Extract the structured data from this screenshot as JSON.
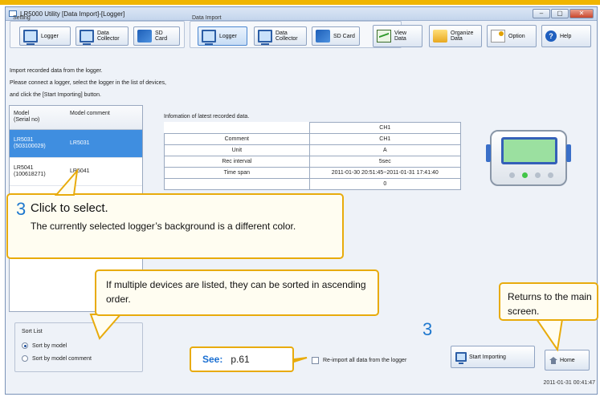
{
  "window": {
    "title": "LR5000 Utility [Data Import]-[Logger]",
    "controls": [
      "–",
      "▢",
      "✕"
    ]
  },
  "toolbar": {
    "setting_label": "Setting",
    "data_import_label": "Data Import",
    "setting_buttons": [
      {
        "label": "Logger",
        "icon": "logger-icon"
      },
      {
        "label": "Data\nCollector",
        "icon": "data-collector-icon"
      },
      {
        "label": "SD Card",
        "icon": "sd-card-icon"
      }
    ],
    "import_buttons": [
      {
        "label": "Logger",
        "icon": "logger-icon",
        "active": true
      },
      {
        "label": "Data\nCollector",
        "icon": "data-collector-icon"
      },
      {
        "label": "SD Card",
        "icon": "sd-card-icon"
      }
    ],
    "right_buttons": [
      {
        "label": "View\nData",
        "icon": "chart-icon"
      },
      {
        "label": "Organize\nData",
        "icon": "folder-icon"
      },
      {
        "label": "Option",
        "icon": "option-icon"
      },
      {
        "label": "Help",
        "icon": "help-icon"
      }
    ]
  },
  "instructions": [
    "Import recorded data from the logger.",
    "Please connect a logger, select the logger in the list of devices,",
    "and click the [Start Importing] button."
  ],
  "device_list": {
    "columns": [
      "Model\n(Serial no)",
      "Model comment"
    ],
    "rows": [
      {
        "model": "LR5031\n(503100029)",
        "comment": "LR5031",
        "selected": true
      },
      {
        "model": "LR5041\n(100618271)",
        "comment": "LR5041",
        "selected": false
      }
    ]
  },
  "info": {
    "caption": "Infomation of latest recorded data.",
    "header": "CH1",
    "rows": [
      {
        "label": "Comment",
        "value": "CH1"
      },
      {
        "label": "Unit",
        "value": "A"
      },
      {
        "label": "Rec interval",
        "value": "5sec"
      },
      {
        "label": "Time span",
        "value": "2011-01-30 20:51:45~2011-01-31 17:41:40"
      },
      {
        "label": "",
        "value": "0"
      }
    ]
  },
  "sort": {
    "title": "Sort List",
    "options": [
      {
        "label": "Sort by model",
        "selected": true
      },
      {
        "label": "Sort by model comment",
        "selected": false
      }
    ]
  },
  "reimport_label": "Re-import all data from the logger",
  "start_button": "Start Importing",
  "home_button": "Home",
  "status_time": "2011-01-31 00:41:47",
  "annotations": {
    "step_number": "3",
    "select_title": "Click to select.",
    "select_body": "The currently selected logger’s background is a different color.",
    "sort_note": "If multiple devices are listed, they can be sorted in ascending order.",
    "home_note": "Returns to the main screen.",
    "see_label": "See:",
    "see_page": "p.61"
  },
  "colors": {
    "accent": "#e8ab0c",
    "selection": "#3f8ee0",
    "step_number": "#1f78ce"
  }
}
